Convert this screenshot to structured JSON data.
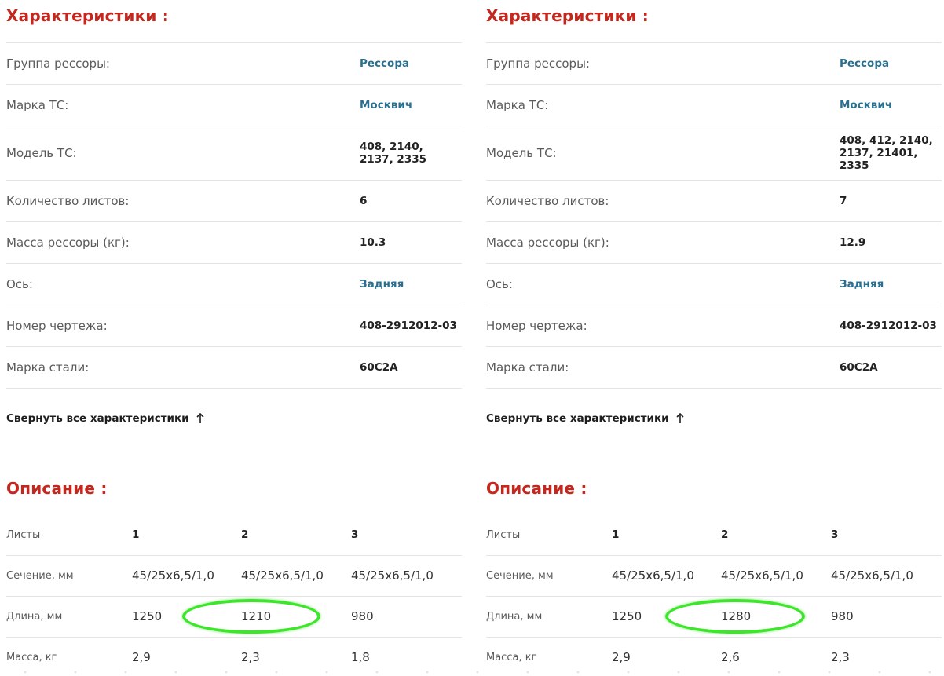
{
  "columns": [
    {
      "characteristics_title": "Характеристики :",
      "specs": [
        {
          "label": "Группа рессоры:",
          "value": "Рессора"
        },
        {
          "label": "Марка ТС:",
          "value": "Москвич"
        },
        {
          "label": "Модель ТС:",
          "value": "408, 2140, 2137, 2335"
        },
        {
          "label": "Количество листов:",
          "value": "6"
        },
        {
          "label": "Масса рессоры (кг):",
          "value": "10.3"
        },
        {
          "label": "Ось:",
          "value": "Задняя"
        },
        {
          "label": "Номер чертежа:",
          "value": "408-2912012-03"
        },
        {
          "label": "Марка стали:",
          "value": "60С2А"
        }
      ],
      "collapse_label": "Свернуть все характеристики",
      "description_title": "Описание :",
      "description_table": {
        "header": {
          "label": "Листы",
          "cells": [
            "1",
            "2",
            "3"
          ]
        },
        "rows": [
          {
            "label": "Сечение, мм",
            "cells": [
              "45/25х6,5/1,0",
              "45/25х6,5/1,0",
              "45/25х6,5/1,0"
            ]
          },
          {
            "label": "Длина, мм",
            "cells": [
              "1250",
              "1210",
              "980"
            ]
          },
          {
            "label": "Масса, кг",
            "cells": [
              "2,9",
              "2,3",
              "1,8"
            ]
          }
        ]
      }
    },
    {
      "characteristics_title": "Характеристики :",
      "specs": [
        {
          "label": "Группа рессоры:",
          "value": "Рессора"
        },
        {
          "label": "Марка ТС:",
          "value": "Москвич"
        },
        {
          "label": "Модель ТС:",
          "value": "408, 412, 2140, 2137, 21401, 2335"
        },
        {
          "label": "Количество листов:",
          "value": "7"
        },
        {
          "label": "Масса рессоры (кг):",
          "value": "12.9"
        },
        {
          "label": "Ось:",
          "value": "Задняя"
        },
        {
          "label": "Номер чертежа:",
          "value": "408-2912012-03"
        },
        {
          "label": "Марка стали:",
          "value": "60С2А"
        }
      ],
      "collapse_label": "Свернуть все характеристики",
      "description_title": "Описание :",
      "description_table": {
        "header": {
          "label": "Листы",
          "cells": [
            "1",
            "2",
            "3"
          ]
        },
        "rows": [
          {
            "label": "Сечение, мм",
            "cells": [
              "45/25х6,5/1,0",
              "45/25х6,5/1,0",
              "45/25х6,5/1,0"
            ]
          },
          {
            "label": "Длина, мм",
            "cells": [
              "1250",
              "1280",
              "980"
            ]
          },
          {
            "label": "Масса, кг",
            "cells": [
              "2,9",
              "2,6",
              "2,3"
            ]
          }
        ]
      }
    }
  ],
  "colors": {
    "title_red": "#c3271d",
    "link_blue": "#2a6f8f",
    "highlight_green": "#3de62a"
  },
  "icons": {
    "collapse": "arrow-up-icon"
  }
}
